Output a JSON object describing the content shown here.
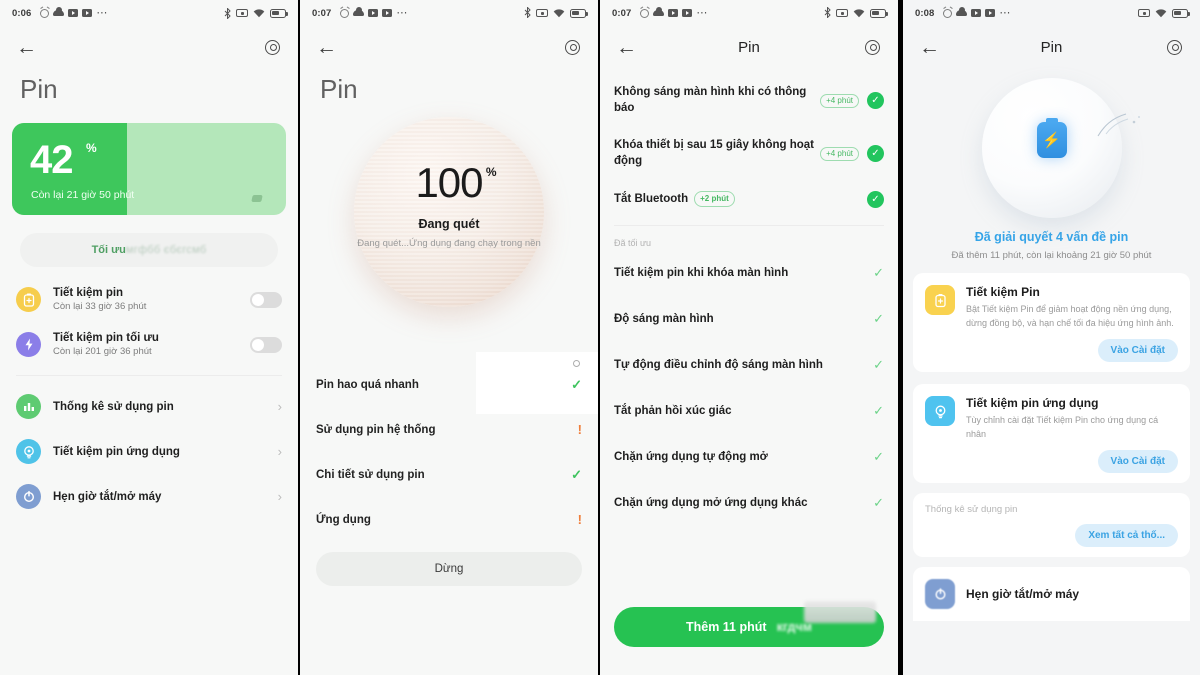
{
  "panels": [
    {
      "statusbar": {
        "time": "0:06",
        "left_icons": [
          "alarm-icon",
          "cloud-icon",
          "video-icon",
          "video-icon",
          "more-dots-icon"
        ],
        "right_icons": [
          "bluetooth-icon",
          "camera-icon",
          "wifi-icon",
          "battery-icon"
        ]
      },
      "nav": {
        "back": "←",
        "gear": "gear-icon"
      },
      "page_title": "Pin",
      "battery_card": {
        "percent": "42",
        "percent_symbol": "%",
        "fill_ratio": 42,
        "subtitle": "Còn lại 21 giờ 50 phút",
        "fill_color": "#3ec75c",
        "track_color": "#b4e7ba"
      },
      "optimize_button": {
        "label": "Tối ưu",
        "blurred_tail": "мгфбб єбєгсмб"
      },
      "toggle_rows": [
        {
          "icon": "battery-saver-icon",
          "title": "Tiết kiệm pin",
          "subtitle": "Còn lại 33 giờ 36 phút",
          "toggle": "off",
          "icon_color": "#f6cd4c"
        },
        {
          "icon": "bolt-icon",
          "title": "Tiết kiệm pin tối ưu",
          "subtitle": "Còn lại 201 giờ 36 phút",
          "toggle": "off",
          "icon_color": "#8b7ee8"
        }
      ],
      "nav_rows": [
        {
          "icon": "bar-chart-icon",
          "title": "Thống kê sử dụng pin",
          "icon_color": "#5ecb72"
        },
        {
          "icon": "bulb-icon",
          "title": "Tiết kiệm pin ứng dụng",
          "icon_color": "#4fc3e8"
        },
        {
          "icon": "power-icon",
          "title": "Hẹn giờ tắt/mở máy",
          "icon_color": "#7f9ed1"
        }
      ]
    },
    {
      "statusbar": {
        "time": "0:07",
        "left_icons": [
          "alarm-icon",
          "cloud-icon",
          "video-icon",
          "video-icon",
          "more-dots-icon"
        ],
        "right_icons": [
          "bluetooth-icon",
          "camera-icon",
          "wifi-icon",
          "battery-icon"
        ]
      },
      "nav": {
        "back": "←",
        "gear": "gear-icon"
      },
      "page_title": "Pin",
      "scan": {
        "number": "100",
        "symbol": "%",
        "state": "Đang quét",
        "description": "Đang quét...Ứng dụng đang chạy trong nền"
      },
      "scan_items": [
        {
          "label": "Pin hao quá nhanh",
          "mark": "✓",
          "status": "ok"
        },
        {
          "label": "Sử dụng pin hệ thống",
          "mark": "!",
          "status": "warn"
        },
        {
          "label": "Chi tiết sử dụng pin",
          "mark": "✓",
          "status": "ok"
        },
        {
          "label": "Ứng dụng",
          "mark": "!",
          "status": "warn"
        }
      ],
      "stop_button": "Dừng"
    },
    {
      "statusbar": {
        "time": "0:07",
        "left_icons": [
          "alarm-icon",
          "cloud-icon",
          "video-icon",
          "video-icon",
          "more-dots-icon"
        ],
        "right_icons": [
          "bluetooth-icon",
          "camera-icon",
          "wifi-icon",
          "battery-icon"
        ]
      },
      "nav": {
        "back": "←",
        "title": "Pin",
        "gear": "gear-icon"
      },
      "pending_items": [
        {
          "label": "Không sáng màn hình khi có thông báo",
          "badge": "+4 phút",
          "checked": true
        },
        {
          "label": "Khóa thiết bị sau 15 giây không hoạt động",
          "badge": "+4 phút",
          "checked": true
        },
        {
          "label": "Tắt Bluetooth",
          "badge": "+2 phút",
          "checked": true,
          "badge_inline": true
        }
      ],
      "section_label": "Đã tối ưu",
      "done_items": [
        {
          "label": "Tiết kiệm pin khi khóa màn hình"
        },
        {
          "label": "Độ sáng màn hình"
        },
        {
          "label": "Tự động điều chỉnh độ sáng màn hình"
        },
        {
          "label": "Tắt phản hồi xúc giác"
        },
        {
          "label": "Chặn ứng dụng tự động mở"
        },
        {
          "label": "Chặn ứng dụng mở ứng dụng khác"
        }
      ],
      "action_button": {
        "label": "Thêm 11 phút",
        "blurred_tail": "кгдчм"
      }
    },
    {
      "statusbar": {
        "time": "0:08",
        "left_icons": [
          "alarm-icon",
          "cloud-icon",
          "video-icon",
          "video-icon",
          "more-dots-icon"
        ],
        "right_icons": [
          "camera-icon",
          "wifi-icon",
          "battery-icon"
        ]
      },
      "nav": {
        "back": "←",
        "title": "Pin",
        "gear": "gear-icon"
      },
      "hero": {
        "icon": "battery-charging-icon",
        "icon_color": "#3d9fe8",
        "title": "Đã giải quyết 4 vấn đề pin",
        "subtitle": "Đã thêm 11 phút, còn lại khoảng 21 giờ 50 phút"
      },
      "cards": [
        {
          "icon": "battery-saver-icon",
          "icon_color": "#f9d24f",
          "title": "Tiết kiệm Pin",
          "desc": "Bật Tiết kiệm Pin để giảm hoạt động nền ứng dụng, dừng đồng bộ, và hạn chế tối đa hiệu ứng hình ảnh.",
          "button": "Vào Cài đặt"
        },
        {
          "icon": "bulb-icon",
          "icon_color": "#4fc3ef",
          "title": "Tiết kiệm pin ứng dụng",
          "desc": "Tùy chỉnh cài đặt Tiết kiệm Pin cho ứng dụng cá nhân",
          "button": "Vào Cài đặt"
        }
      ],
      "stats_card": {
        "label": "Thống kê sử dụng pin",
        "button": "Xem tất cả thố..."
      },
      "last_row": {
        "icon": "power-icon",
        "title": "Hẹn giờ tắt/mở máy"
      }
    }
  ]
}
